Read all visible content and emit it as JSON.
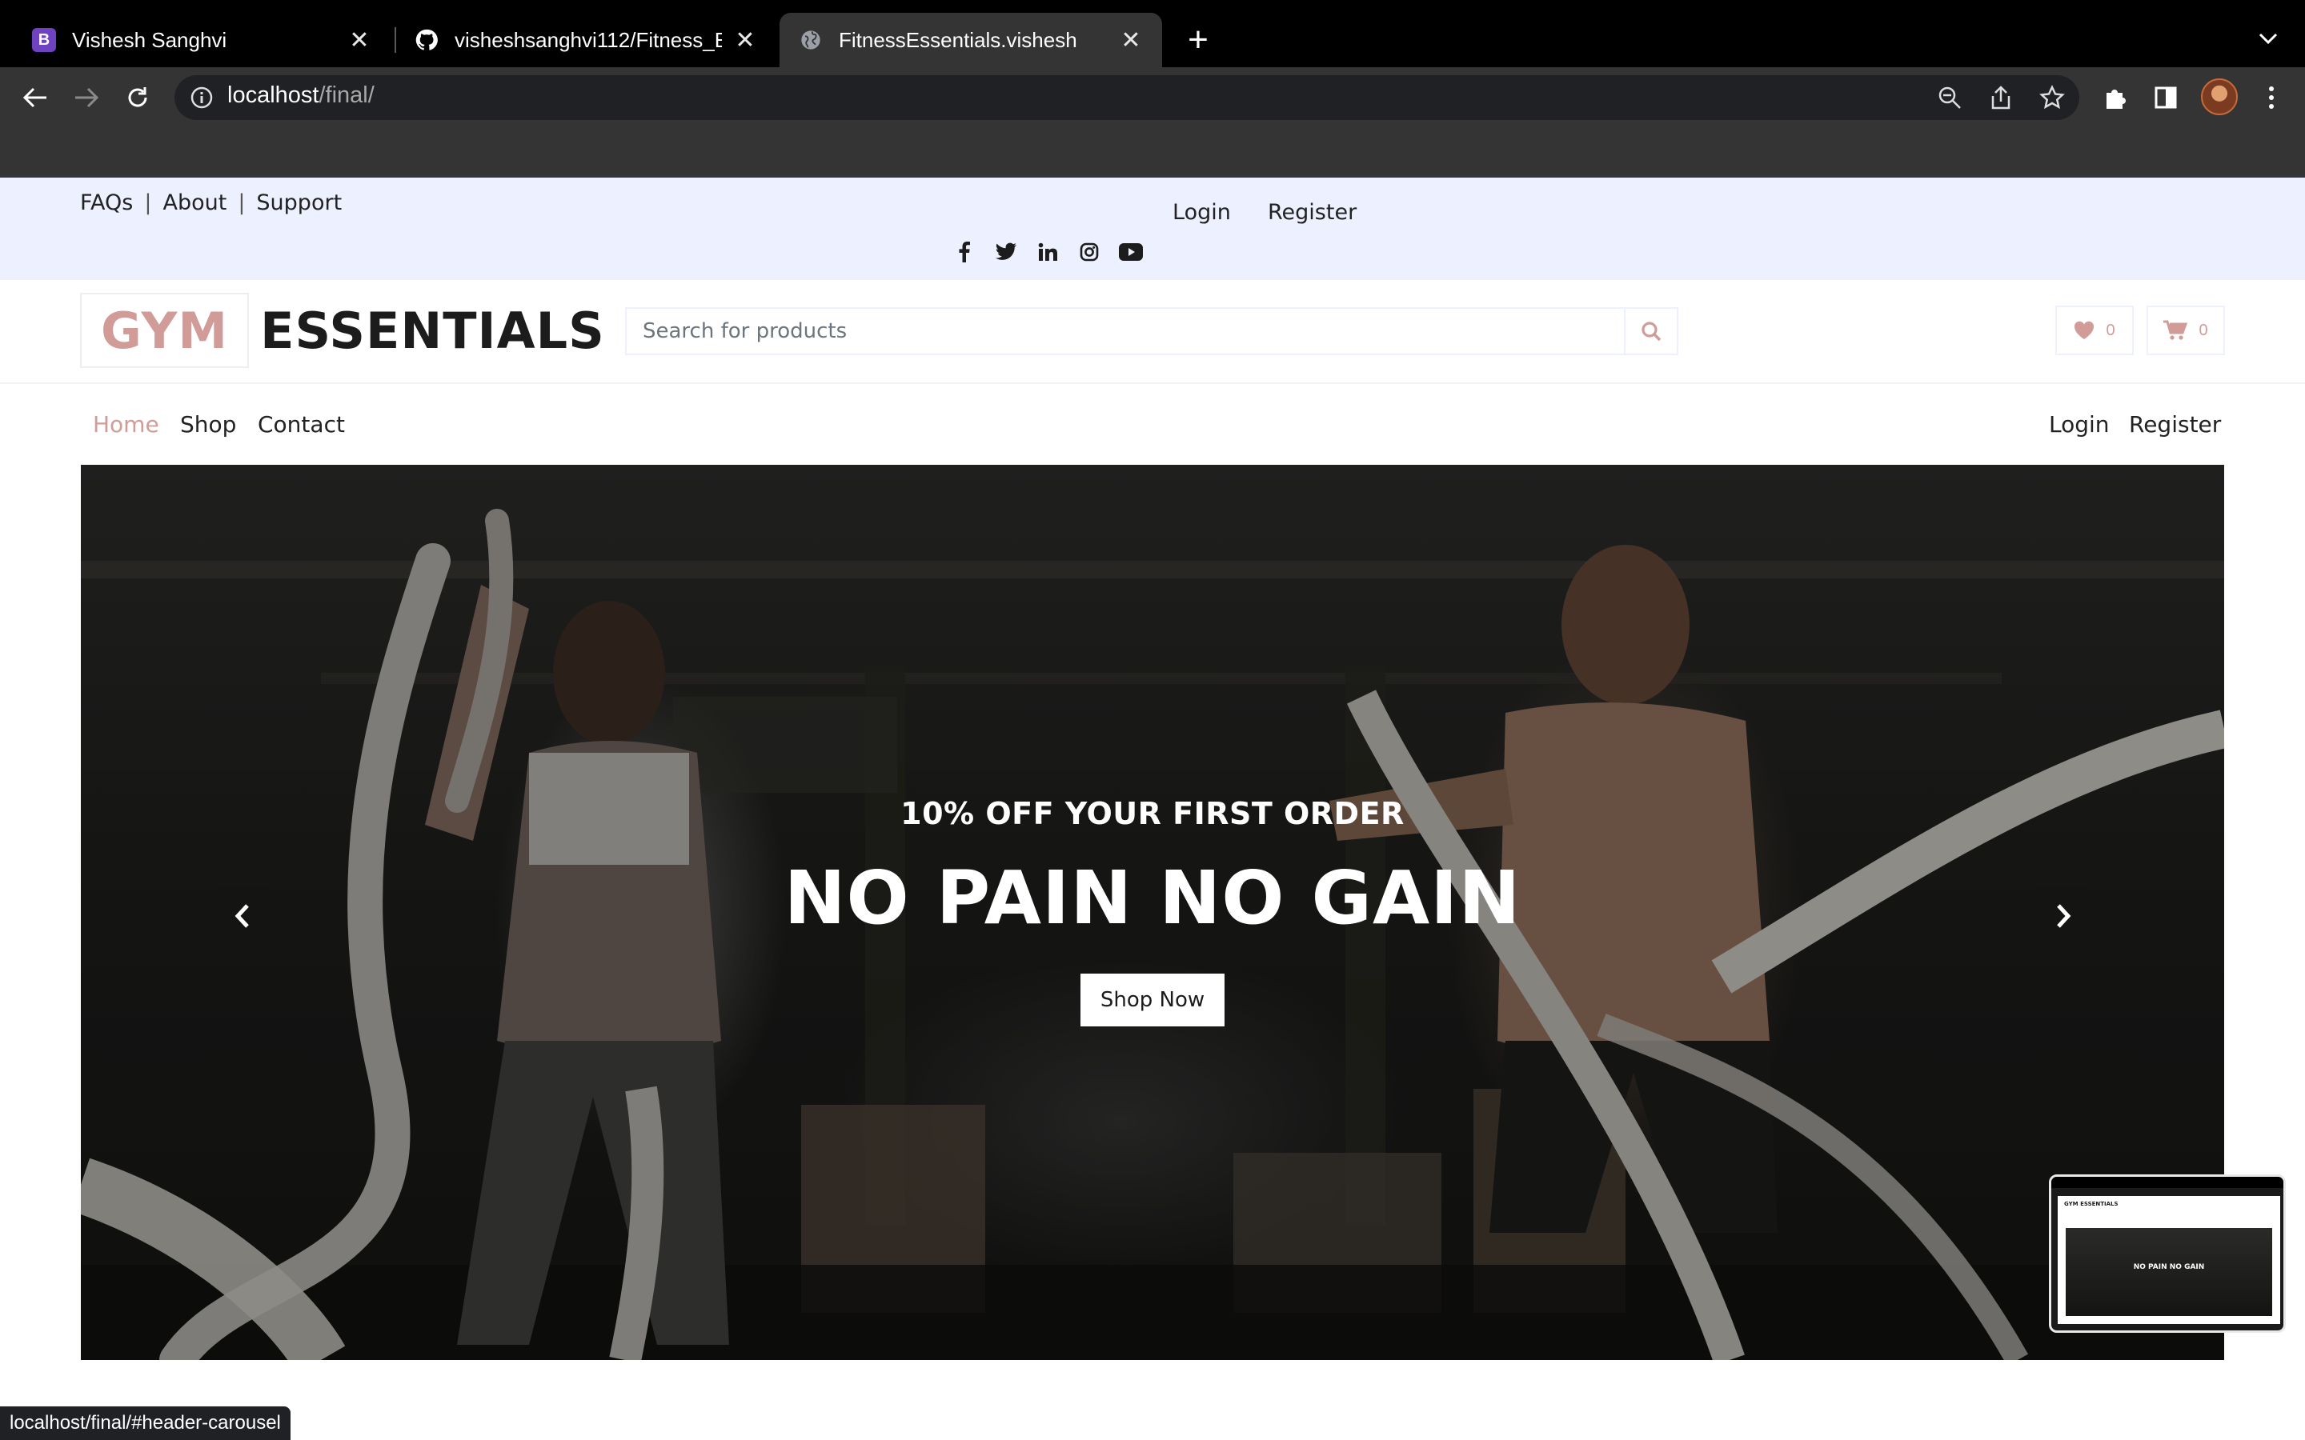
{
  "browser": {
    "tabs": [
      {
        "title": "Vishesh Sanghvi",
        "favicon": "B"
      },
      {
        "title": "visheshsanghvi112/Fitness_Ess"
      },
      {
        "title": "FitnessEssentials.vishesh"
      }
    ],
    "url_host": "localhost",
    "url_path": "/final/",
    "status_url": "localhost/final/#header-carousel"
  },
  "topbar": {
    "links": [
      "FAQs",
      "About",
      "Support"
    ],
    "separator": "|",
    "login": "Login",
    "register": "Register",
    "socials": [
      "facebook-icon",
      "twitter-icon",
      "linkedin-icon",
      "instagram-icon",
      "youtube-icon"
    ]
  },
  "header": {
    "logo_part1": "GYM",
    "logo_part2": "ESSENTIALS",
    "search_placeholder": "Search for products",
    "wishlist_count": "0",
    "cart_count": "0",
    "accent_color": "#d19c97"
  },
  "nav": {
    "home": "Home",
    "shop": "Shop",
    "contact": "Contact",
    "login": "Login",
    "register": "Register"
  },
  "hero": {
    "subtitle": "10% OFF YOUR FIRST ORDER",
    "title": "NO PAIN NO GAIN",
    "cta": "Shop Now"
  },
  "pip": {
    "logo": "GYM ESSENTIALS",
    "title": "NO PAIN NO GAIN"
  }
}
